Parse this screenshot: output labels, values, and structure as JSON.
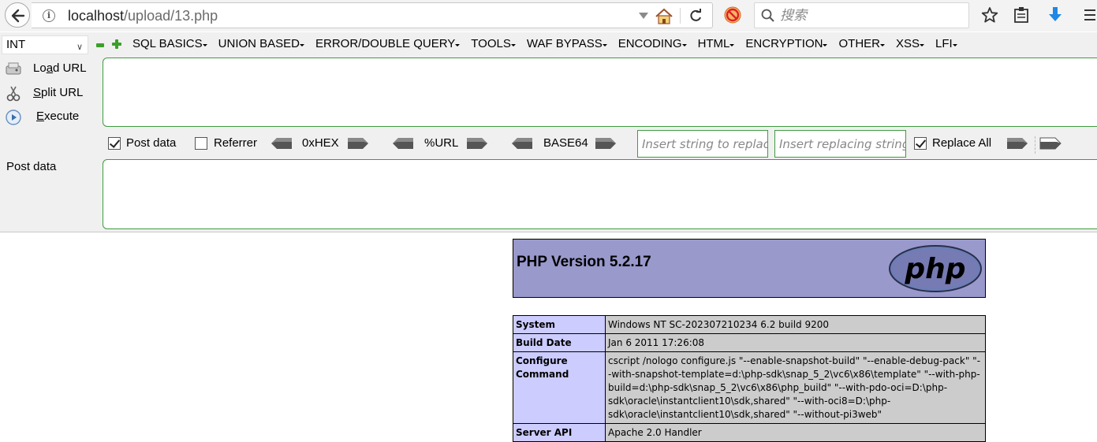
{
  "browser": {
    "url_host": "localhost",
    "url_path": "/upload/13.php",
    "search_placeholder": "搜索"
  },
  "hackbar": {
    "encoding_select": "INT",
    "menus": [
      "SQL BASICS",
      "UNION BASED",
      "ERROR/DOUBLE QUERY",
      "TOOLS",
      "WAF BYPASS",
      "ENCODING",
      "HTML",
      "ENCRYPTION",
      "OTHER",
      "XSS",
      "LFI"
    ],
    "load_url_pre": "Lo",
    "load_url_key": "a",
    "load_url_post": "d URL",
    "split_url_key": "S",
    "split_url_post": "plit URL",
    "execute_key": "E",
    "execute_post": "xecute",
    "url_value": "",
    "post_data_checkbox": "Post data",
    "referrer_checkbox": "Referrer",
    "hex_label": "0xHEX",
    "url_label": "%URL",
    "base64_label": "BASE64",
    "replace_placeholder": "Insert string to replace",
    "replacing_placeholder": "Insert replacing string",
    "replace_all_label": "Replace All",
    "post_data_label": "Post data",
    "post_value": "",
    "colors": {
      "border_green": "#3f9b3f",
      "plus_minus_green": "#3aa02a"
    }
  },
  "phpinfo": {
    "title": "PHP Version 5.2.17",
    "logo_text": "php",
    "colors": {
      "header": "#9999cc",
      "key_cell": "#ccccff",
      "value_cell": "#cccccc"
    },
    "rows": [
      {
        "key": "System",
        "value": "Windows NT SC-202307210234 6.2 build 9200"
      },
      {
        "key": "Build Date",
        "value": "Jan 6 2011 17:26:08"
      },
      {
        "key": "Configure Command",
        "value": "cscript /nologo configure.js \"--enable-snapshot-build\" \"--enable-debug-pack\" \"--with-snapshot-template=d:\\php-sdk\\snap_5_2\\vc6\\x86\\template\" \"--with-php-build=d:\\php-sdk\\snap_5_2\\vc6\\x86\\php_build\" \"--with-pdo-oci=D:\\php-sdk\\oracle\\instantclient10\\sdk,shared\" \"--with-oci8=D:\\php-sdk\\oracle\\instantclient10\\sdk,shared\" \"--without-pi3web\""
      },
      {
        "key": "Server API",
        "value": "Apache 2.0 Handler"
      }
    ]
  }
}
